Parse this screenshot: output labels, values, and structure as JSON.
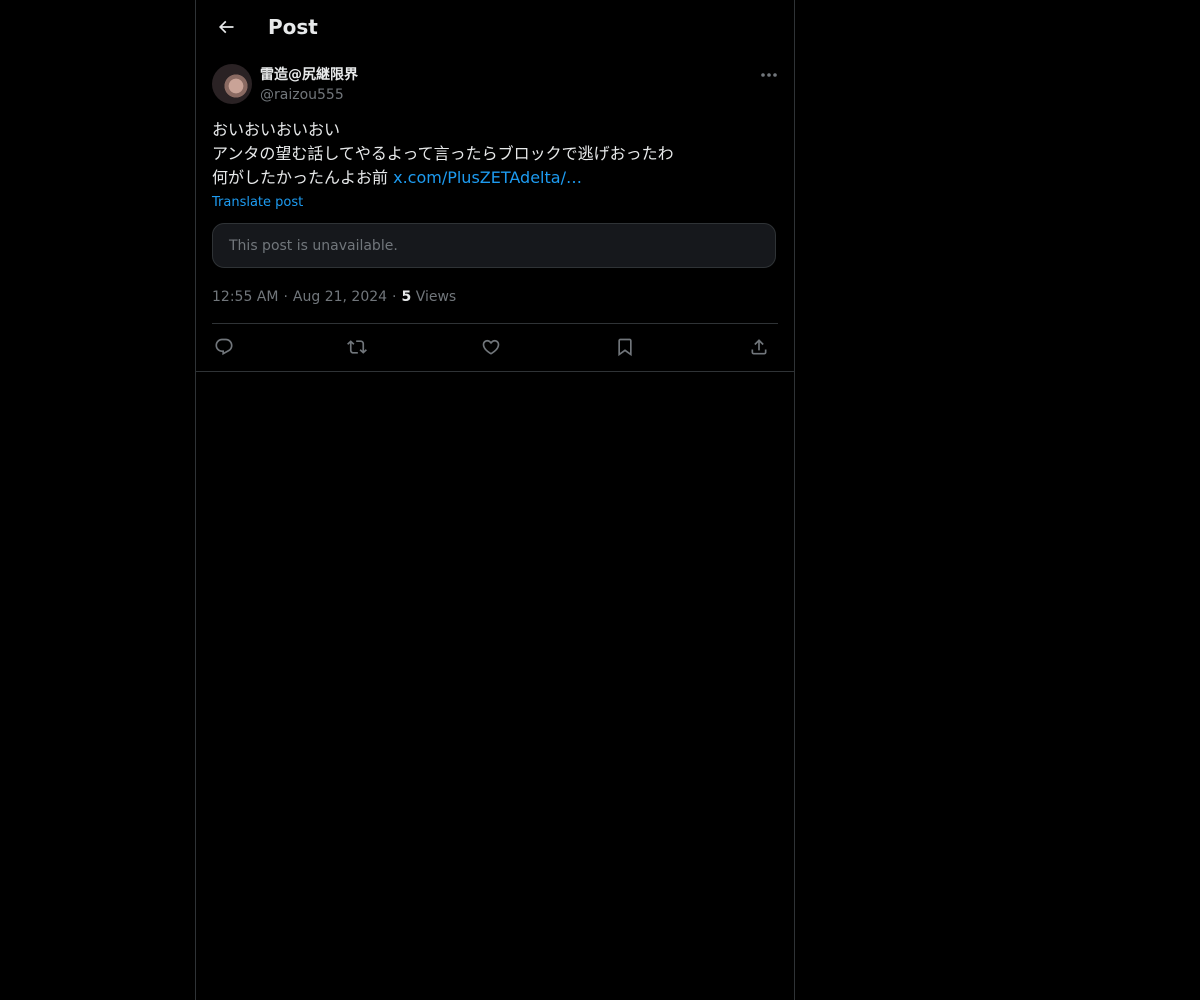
{
  "header": {
    "title": "Post",
    "back_icon": "arrow-left-icon"
  },
  "tweet": {
    "author": {
      "display_name": "雷造@尻継限界",
      "handle": "@raizou555"
    },
    "text_lines": [
      "おいおいおいおい",
      "アンタの望む話してやるよって言ったらブロックで逃げおったわ",
      "何がしたかったんよお前 "
    ],
    "link_text": "x.com/PlusZETAdelta/…",
    "translate_label": "Translate post",
    "quoted_unavailable": "This post is unavailable.",
    "time": "12:55 AM",
    "date": "Aug 21, 2024",
    "views_count": "5",
    "views_label": " Views",
    "separator": "·"
  },
  "actions": [
    "reply-icon",
    "repost-icon",
    "like-icon",
    "bookmark-icon",
    "share-icon"
  ],
  "colors": {
    "background": "#000000",
    "text": "#e7e9ea",
    "muted": "#71767b",
    "accent": "#1d9bf0",
    "border": "#2f3336"
  }
}
